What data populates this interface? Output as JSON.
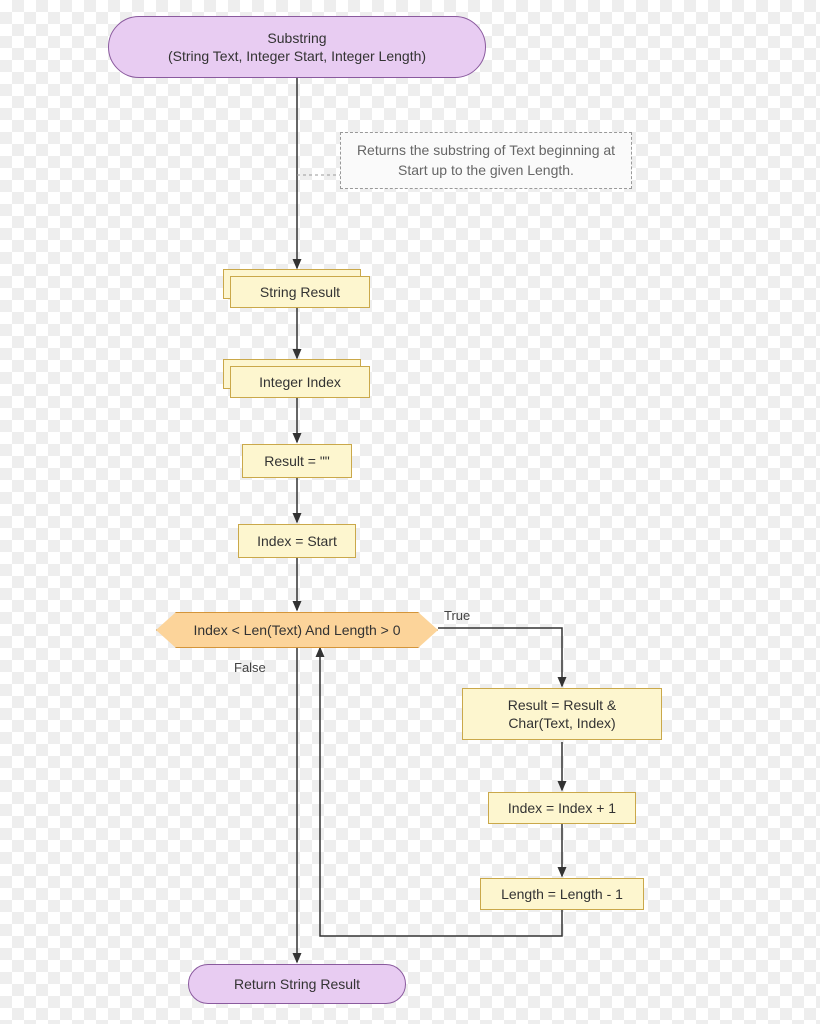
{
  "terminal_start": {
    "title": "Substring",
    "params": "(String Text, Integer Start, Integer Length)"
  },
  "annotation": "Returns the substring of Text beginning at Start up to the given Length.",
  "declare1": "String Result",
  "declare2": "Integer Index",
  "process1": "Result = \"\"",
  "process2": "Index = Start",
  "decision": "Index < Len(Text) And Length > 0",
  "labels": {
    "true": "True",
    "false": "False"
  },
  "loop_body1": "Result = Result & Char(Text, Index)",
  "loop_body2": "Index = Index + 1",
  "loop_body3": "Length = Length - 1",
  "terminal_end": "Return String Result",
  "colors": {
    "terminal_bg": "#e8ccf2",
    "terminal_border": "#8a5a9e",
    "process_bg": "#fdf6cf",
    "process_border": "#caa84a",
    "decision_bg": "#fcd49a",
    "decision_border": "#d4953a"
  }
}
